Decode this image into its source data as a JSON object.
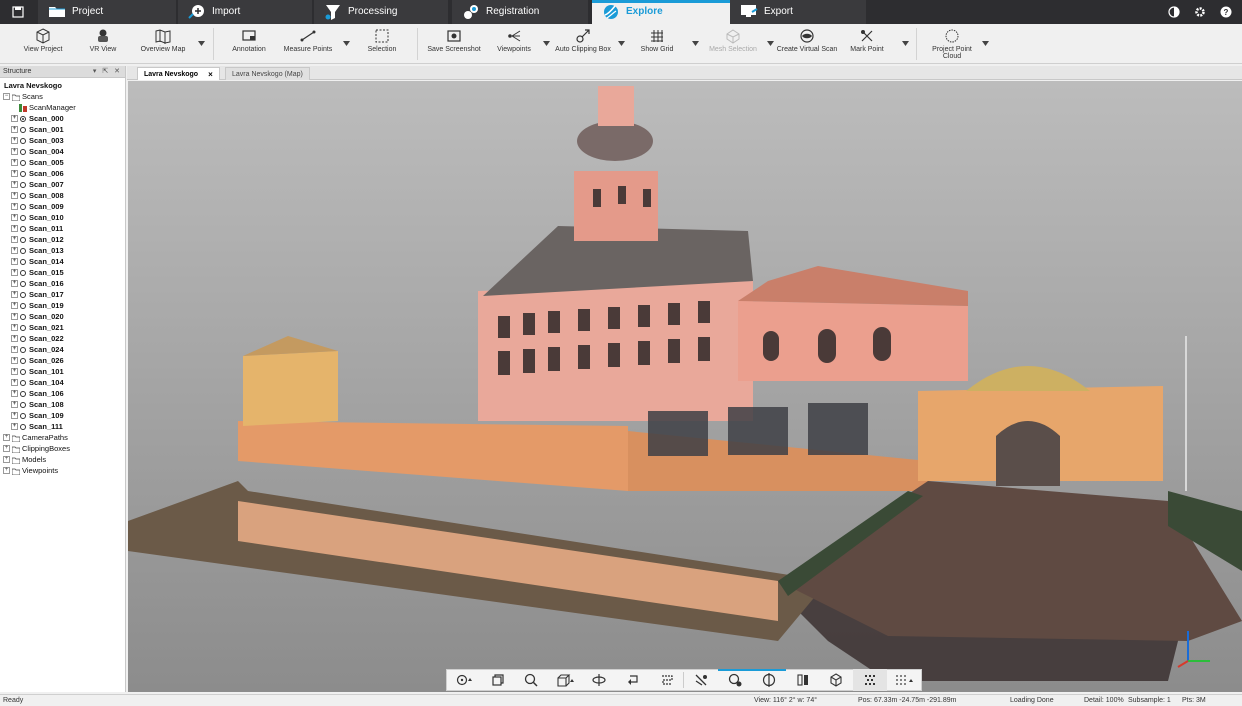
{
  "main_tabs": [
    {
      "label": "Project",
      "icon": "folder-icon"
    },
    {
      "label": "Import",
      "icon": "import-plus-icon"
    },
    {
      "label": "Processing",
      "icon": "funnel-icon"
    },
    {
      "label": "Registration",
      "icon": "registration-icon"
    },
    {
      "label": "Explore",
      "icon": "explore-globe-icon",
      "active": true
    },
    {
      "label": "Export",
      "icon": "export-monitor-icon"
    }
  ],
  "accent_color": "#1a9bd7",
  "ribbon": {
    "view_project": "View Project",
    "vr_view": "VR View",
    "overview_map": "Overview Map",
    "annotation": "Annotation",
    "measure_points": "Measure Points",
    "selection": "Selection",
    "save_screenshot": "Save Screenshot",
    "viewpoints": "Viewpoints",
    "auto_clipping_box": "Auto Clipping Box",
    "show_grid": "Show Grid",
    "mesh_selection": "Mesh Selection",
    "create_virtual_scan": "Create Virtual Scan",
    "mark_point": "Mark Point",
    "project_point_cloud_1": "Project Point",
    "project_point_cloud_2": "Cloud"
  },
  "structure_panel": {
    "title": "Structure",
    "controls": "▾ ⇱ ✕",
    "root": "Lavra Nevskogo",
    "scans_folder": "Scans",
    "scan_manager": "ScanManager",
    "scans": [
      "Scan_000",
      "Scan_001",
      "Scan_003",
      "Scan_004",
      "Scan_005",
      "Scan_006",
      "Scan_007",
      "Scan_008",
      "Scan_009",
      "Scan_010",
      "Scan_011",
      "Scan_012",
      "Scan_013",
      "Scan_014",
      "Scan_015",
      "Scan_016",
      "Scan_017",
      "Scan_019",
      "Scan_020",
      "Scan_021",
      "Scan_022",
      "Scan_024",
      "Scan_026",
      "Scan_101",
      "Scan_104",
      "Scan_106",
      "Scan_108",
      "Scan_109",
      "Scan_111"
    ],
    "folders": [
      "CameraPaths",
      "ClippingBoxes",
      "Models",
      "Viewpoints"
    ]
  },
  "doc_tabs": [
    {
      "label": "Lavra Nevskogo",
      "close": "×"
    },
    {
      "label": "Lavra Nevskogo (Map)"
    }
  ],
  "status": {
    "ready": "Ready",
    "view": "View: 116° 2° w: 74°",
    "pos": "Pos: 67.33m -24.75m -291.89m",
    "loading": "Loading Done",
    "detail": "Detail: 100%",
    "subsample": "Subsample: 1",
    "pts": "Pts: 3M"
  }
}
